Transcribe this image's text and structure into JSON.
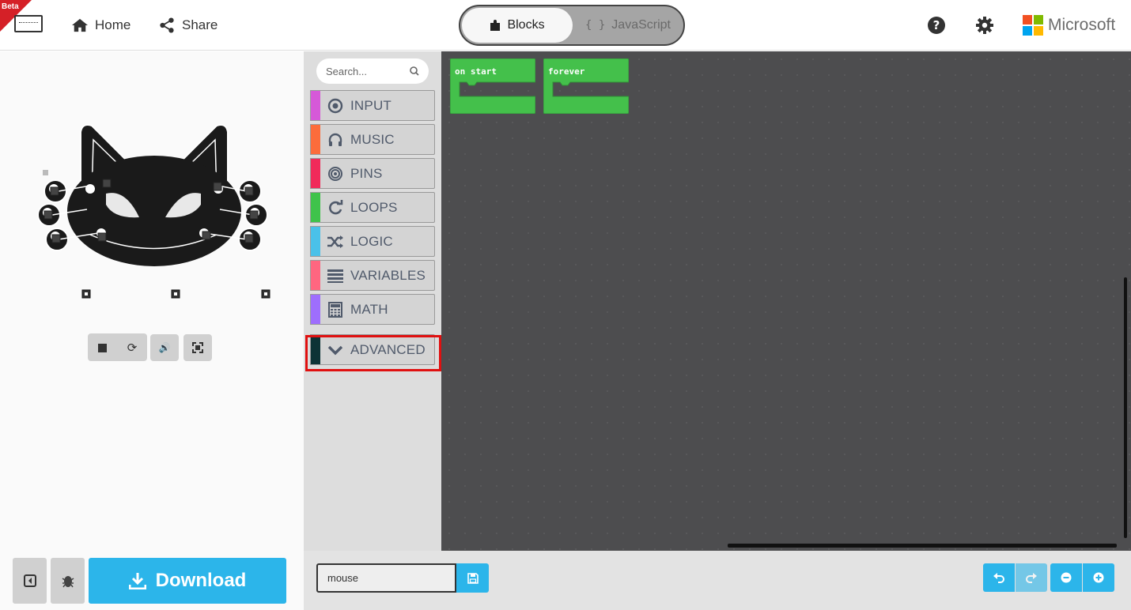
{
  "header": {
    "beta_label": "Beta",
    "home_label": "Home",
    "share_label": "Share",
    "blocks_label": "Blocks",
    "javascript_label": "JavaScript",
    "microsoft_label": "Microsoft",
    "icons": [
      "home-icon",
      "share-icon",
      "puzzle-icon",
      "braces-icon",
      "help-icon",
      "gear-icon",
      "microsoft-logo"
    ]
  },
  "toolbox": {
    "search_placeholder": "Search...",
    "categories": [
      {
        "label": "INPUT",
        "color": "#d659d8",
        "icon": "target-icon"
      },
      {
        "label": "MUSIC",
        "color": "#fc6c3b",
        "icon": "headphones-icon"
      },
      {
        "label": "PINS",
        "color": "#f12a5a",
        "icon": "pins-icon"
      },
      {
        "label": "LOOPS",
        "color": "#3fc34b",
        "icon": "loop-icon"
      },
      {
        "label": "LOGIC",
        "color": "#4ac1e9",
        "icon": "shuffle-icon"
      },
      {
        "label": "VARIABLES",
        "color": "#ff6680",
        "icon": "lines-icon"
      },
      {
        "label": "MATH",
        "color": "#9e6efd",
        "icon": "calculator-icon"
      }
    ],
    "advanced_label": "ADVANCED",
    "advanced_color": "#0d3336"
  },
  "workspace": {
    "blocks": [
      {
        "label": "on start",
        "color": "#44c04b"
      },
      {
        "label": "forever",
        "color": "#44c04b"
      }
    ]
  },
  "simulator": {
    "download_label": "Download"
  },
  "footer": {
    "project_name": "mouse"
  },
  "colors": {
    "accent": "#2cb5ea",
    "workspace_bg": "#4d4d4f",
    "highlight": "#e01010"
  }
}
